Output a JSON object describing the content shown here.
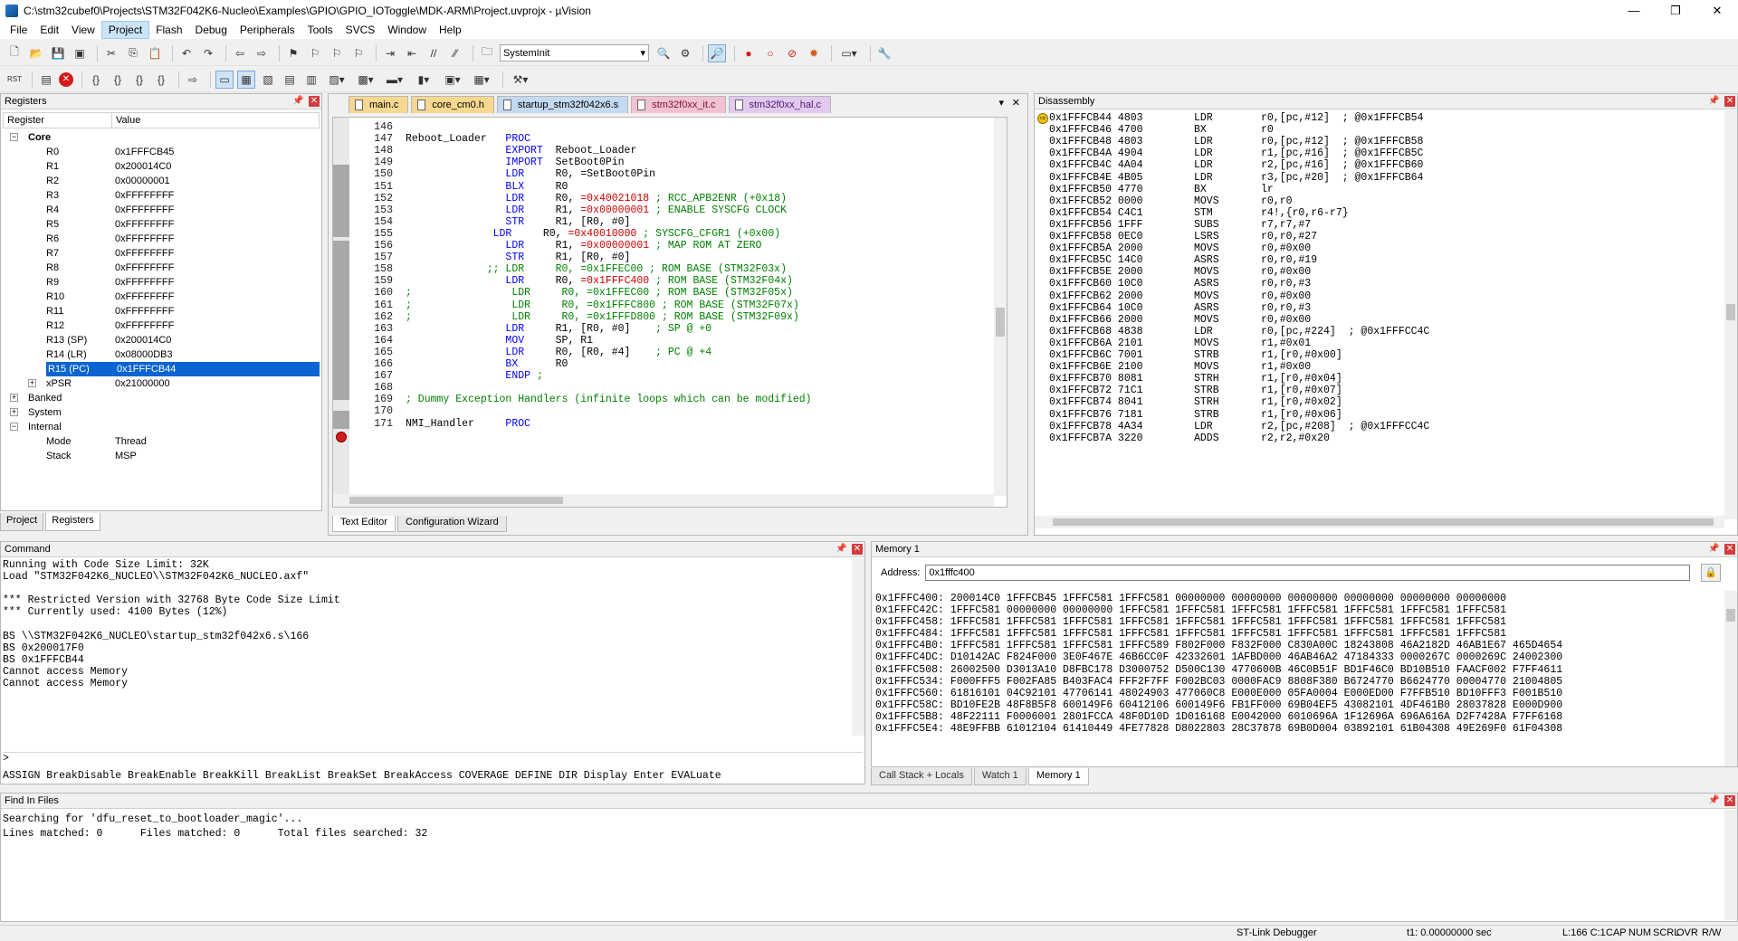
{
  "titlebar": {
    "title": "C:\\stm32cubef0\\Projects\\STM32F042K6-Nucleo\\Examples\\GPIO\\GPIO_IOToggle\\MDK-ARM\\Project.uvprojx - µVision",
    "minimize": "—",
    "maximize": "❐",
    "close": "✕"
  },
  "menu": [
    "File",
    "Edit",
    "View",
    "Project",
    "Flash",
    "Debug",
    "Peripherals",
    "Tools",
    "SVCS",
    "Window",
    "Help"
  ],
  "toolbar": {
    "function_combo": "SystemInit"
  },
  "registers": {
    "title": "Registers",
    "col_register": "Register",
    "col_value": "Value",
    "core_label": "Core",
    "rows": [
      {
        "name": "R0",
        "value": "0x1FFFCB45"
      },
      {
        "name": "R1",
        "value": "0x200014C0"
      },
      {
        "name": "R2",
        "value": "0x00000001"
      },
      {
        "name": "R3",
        "value": "0xFFFFFFFF"
      },
      {
        "name": "R4",
        "value": "0xFFFFFFFF"
      },
      {
        "name": "R5",
        "value": "0xFFFFFFFF"
      },
      {
        "name": "R6",
        "value": "0xFFFFFFFF"
      },
      {
        "name": "R7",
        "value": "0xFFFFFFFF"
      },
      {
        "name": "R8",
        "value": "0xFFFFFFFF"
      },
      {
        "name": "R9",
        "value": "0xFFFFFFFF"
      },
      {
        "name": "R10",
        "value": "0xFFFFFFFF"
      },
      {
        "name": "R11",
        "value": "0xFFFFFFFF"
      },
      {
        "name": "R12",
        "value": "0xFFFFFFFF"
      },
      {
        "name": "R13 (SP)",
        "value": "0x200014C0"
      },
      {
        "name": "R14 (LR)",
        "value": "0x08000DB3"
      },
      {
        "name": "R15 (PC)",
        "value": "0x1FFFCB44"
      },
      {
        "name": "xPSR",
        "value": "0x21000000"
      }
    ],
    "banked_label": "Banked",
    "system_label": "System",
    "internal_label": "Internal",
    "mode_label": "Mode",
    "mode_value": "Thread",
    "stack_label": "Stack",
    "stack_value": "MSP",
    "tabs": [
      "Project",
      "Registers"
    ]
  },
  "editor": {
    "tabs": [
      "main.c",
      "core_cm0.h",
      "startup_stm32f042x6.s",
      "stm32f0xx_it.c",
      "stm32f0xx_hal.c"
    ],
    "bottom_tabs": [
      "Text Editor",
      "Configuration Wizard"
    ],
    "lines": [
      {
        "n": "146",
        "t": ""
      },
      {
        "n": "147",
        "t": "Reboot_Loader   PROC"
      },
      {
        "n": "148",
        "t": "                EXPORT  Reboot_Loader"
      },
      {
        "n": "149",
        "t": "                IMPORT  SetBoot0Pin"
      },
      {
        "n": "150",
        "t": "                LDR     R0, =SetBoot0Pin"
      },
      {
        "n": "151",
        "t": "                BLX     R0"
      },
      {
        "n": "152",
        "t": "                LDR     R0, =0x40021018 ; RCC_APB2ENR (+0x18)"
      },
      {
        "n": "153",
        "t": "                LDR     R1, =0x00000001 ; ENABLE SYSCFG CLOCK"
      },
      {
        "n": "154",
        "t": "                STR     R1, [R0, #0]"
      },
      {
        "n": "155",
        "t": "              LDR     R0, =0x40010000 ; SYSCFG_CFGR1 (+0x00)"
      },
      {
        "n": "156",
        "t": "                LDR     R1, =0x00000001 ; MAP ROM AT ZERO"
      },
      {
        "n": "157",
        "t": "                STR     R1, [R0, #0]"
      },
      {
        "n": "158",
        "t": "             ;; LDR     R0, =0x1FFEC00 ; ROM BASE (STM32F03x)"
      },
      {
        "n": "159",
        "t": "                LDR     R0, =0x1FFFC400 ; ROM BASE (STM32F04x)"
      },
      {
        "n": "160",
        "t": ";                LDR     R0, =0x1FFEC00 ; ROM BASE (STM32F05x)"
      },
      {
        "n": "161",
        "t": ";                LDR     R0, =0x1FFFC800 ; ROM BASE (STM32F07x)"
      },
      {
        "n": "162",
        "t": ";                LDR     R0, =0x1FFFD800 ; ROM BASE (STM32F09x)"
      },
      {
        "n": "163",
        "t": "                LDR     R1, [R0, #0]    ; SP @ +0"
      },
      {
        "n": "164",
        "t": "                MOV     SP, R1"
      },
      {
        "n": "165",
        "t": "                LDR     R0, [R0, #4]    ; PC @ +4"
      },
      {
        "n": "166",
        "t": "                BX      R0"
      },
      {
        "n": "167",
        "t": "                ENDP ;"
      },
      {
        "n": "168",
        "t": ""
      },
      {
        "n": "169",
        "t": "; Dummy Exception Handlers (infinite loops which can be modified)"
      },
      {
        "n": "170",
        "t": ""
      },
      {
        "n": "171",
        "t": "NMI_Handler     PROC"
      }
    ]
  },
  "disassembly": {
    "title": "Disassembly",
    "lines": [
      {
        "a": "0x1FFFCB44 4803",
        "m": "LDR",
        "o": "r0,[pc,#12]  ; @0x1FFFCB54"
      },
      {
        "a": "0x1FFFCB46 4700",
        "m": "BX",
        "o": "r0"
      },
      {
        "a": "0x1FFFCB48 4803",
        "m": "LDR",
        "o": "r0,[pc,#12]  ; @0x1FFFCB58"
      },
      {
        "a": "0x1FFFCB4A 4904",
        "m": "LDR",
        "o": "r1,[pc,#16]  ; @0x1FFFCB5C"
      },
      {
        "a": "0x1FFFCB4C 4A04",
        "m": "LDR",
        "o": "r2,[pc,#16]  ; @0x1FFFCB60"
      },
      {
        "a": "0x1FFFCB4E 4B05",
        "m": "LDR",
        "o": "r3,[pc,#20]  ; @0x1FFFCB64"
      },
      {
        "a": "0x1FFFCB50 4770",
        "m": "BX",
        "o": "lr"
      },
      {
        "a": "0x1FFFCB52 0000",
        "m": "MOVS",
        "o": "r0,r0"
      },
      {
        "a": "0x1FFFCB54 C4C1",
        "m": "STM",
        "o": "r4!,{r0,r6-r7}"
      },
      {
        "a": "0x1FFFCB56 1FFF",
        "m": "SUBS",
        "o": "r7,r7,#7"
      },
      {
        "a": "0x1FFFCB58 0EC0",
        "m": "LSRS",
        "o": "r0,r0,#27"
      },
      {
        "a": "0x1FFFCB5A 2000",
        "m": "MOVS",
        "o": "r0,#0x00"
      },
      {
        "a": "0x1FFFCB5C 14C0",
        "m": "ASRS",
        "o": "r0,r0,#19"
      },
      {
        "a": "0x1FFFCB5E 2000",
        "m": "MOVS",
        "o": "r0,#0x00"
      },
      {
        "a": "0x1FFFCB60 10C0",
        "m": "ASRS",
        "o": "r0,r0,#3"
      },
      {
        "a": "0x1FFFCB62 2000",
        "m": "MOVS",
        "o": "r0,#0x00"
      },
      {
        "a": "0x1FFFCB64 10C0",
        "m": "ASRS",
        "o": "r0,r0,#3"
      },
      {
        "a": "0x1FFFCB66 2000",
        "m": "MOVS",
        "o": "r0,#0x00"
      },
      {
        "a": "0x1FFFCB68 4838",
        "m": "LDR",
        "o": "r0,[pc,#224]  ; @0x1FFFCC4C"
      },
      {
        "a": "0x1FFFCB6A 2101",
        "m": "MOVS",
        "o": "r1,#0x01"
      },
      {
        "a": "0x1FFFCB6C 7001",
        "m": "STRB",
        "o": "r1,[r0,#0x00]"
      },
      {
        "a": "0x1FFFCB6E 2100",
        "m": "MOVS",
        "o": "r1,#0x00"
      },
      {
        "a": "0x1FFFCB70 8081",
        "m": "STRH",
        "o": "r1,[r0,#0x04]"
      },
      {
        "a": "0x1FFFCB72 71C1",
        "m": "STRB",
        "o": "r1,[r0,#0x07]"
      },
      {
        "a": "0x1FFFCB74 8041",
        "m": "STRH",
        "o": "r1,[r0,#0x02]"
      },
      {
        "a": "0x1FFFCB76 7181",
        "m": "STRB",
        "o": "r1,[r0,#0x06]"
      },
      {
        "a": "0x1FFFCB78 4A34",
        "m": "LDR",
        "o": "r2,[pc,#208]  ; @0x1FFFCC4C"
      },
      {
        "a": "0x1FFFCB7A 3220",
        "m": "ADDS",
        "o": "r2,r2,#0x20"
      }
    ]
  },
  "command": {
    "title": "Command",
    "lines": [
      "Running with Code Size Limit: 32K",
      "Load \"STM32F042K6_NUCLEO\\\\STM32F042K6_NUCLEO.axf\"",
      "",
      "*** Restricted Version with 32768 Byte Code Size Limit",
      "*** Currently used: 4100 Bytes (12%)",
      "",
      "BS \\\\STM32F042K6_NUCLEO\\startup_stm32f042x6.s\\166",
      "BS 0x200017F0",
      "BS 0x1FFFCB44",
      "Cannot access Memory",
      "Cannot access Memory"
    ],
    "prompt": ">",
    "help": "ASSIGN BreakDisable BreakEnable BreakKill BreakList BreakSet BreakAccess COVERAGE DEFINE DIR Display Enter EVALuate"
  },
  "memory": {
    "title": "Memory 1",
    "address_label": "Address:",
    "address_value": "0x1fffc400",
    "lines": [
      "0x1FFFC400: 200014C0 1FFFCB45 1FFFC581 1FFFC581 00000000 00000000 00000000 00000000 00000000 00000000",
      "0x1FFFC42C: 1FFFC581 00000000 00000000 1FFFC581 1FFFC581 1FFFC581 1FFFC581 1FFFC581 1FFFC581 1FFFC581",
      "0x1FFFC458: 1FFFC581 1FFFC581 1FFFC581 1FFFC581 1FFFC581 1FFFC581 1FFFC581 1FFFC581 1FFFC581 1FFFC581",
      "0x1FFFC484: 1FFFC581 1FFFC581 1FFFC581 1FFFC581 1FFFC581 1FFFC581 1FFFC581 1FFFC581 1FFFC581 1FFFC581",
      "0x1FFFC4B0: 1FFFC581 1FFFC581 1FFFC581 1FFFC589 F802F000 F832F000 C830A00C 18243808 46A2182D 46AB1E67 465D4654",
      "0x1FFFC4DC: D10142AC F824F000 3E0F467E 46B6CC0F 42332601 1AFBD000 46AB46A2 47184333 0000267C 0000269C 24002300",
      "0x1FFFC508: 26002500 D3013A10 D8FBC178 D3000752 D500C130 4770600B 46C0B51F BD1F46C0 BD10B510 FAACF002 F7FF4611",
      "0x1FFFC534: F000FFF5 F002FA85 B403FAC4 FFF2F7FF F002BC03 0000FAC9 8808F380 B6724770 B6624770 00004770 21004805",
      "0x1FFFC560: 61816101 04C92101 47706141 48024903 477060C8 E000E000 05FA0004 E000ED00 F7FFB510 BD10FFF3 F001B510",
      "0x1FFFC58C: BD10FE2B 48F8B5F8 600149F6 60412106 600149F6 FB1FF000 69B04EF5 43082101 4DF461B0 28037828 E000D900",
      "0x1FFFC5B8: 48F22111 F0006001 2801FCCA 48F0D10D 1D016168 E0042000 6010696A 1F12696A 696A616A D2F7428A F7FF6168",
      "0x1FFFC5E4: 48E9FFBB 61012104 61410449 4FE77828 D8022803 28C37878 69B0D004 03892101 61B04308 49E269F0 61F04308"
    ],
    "tabs": [
      "Call Stack + Locals",
      "Watch 1",
      "Memory 1"
    ]
  },
  "find": {
    "title": "Find In Files",
    "lines": [
      "Searching for 'dfu_reset_to_bootloader_magic'...",
      "Lines matched: 0      Files matched: 0      Total files searched: 32"
    ]
  },
  "status": {
    "debugger": "ST-Link Debugger",
    "time": "t1: 0.00000000 sec",
    "position": "L:166 C:1",
    "caps": "CAP",
    "num": "NUM",
    "scrl": "SCRL",
    "ovr": "OVR",
    "rw": "R/W"
  }
}
